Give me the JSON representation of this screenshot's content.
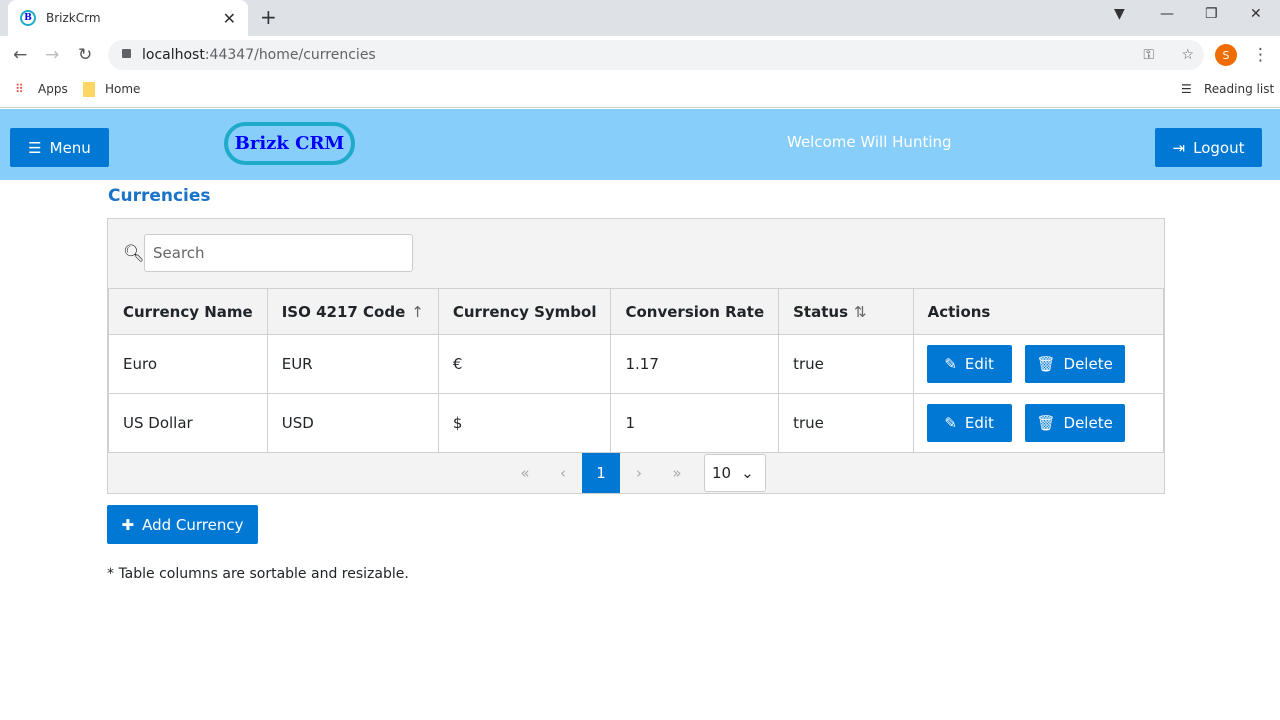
{
  "browser": {
    "tab_title": "BrizkCrm",
    "favicon_letter": "B",
    "url_host": "localhost",
    "url_path": ":44347/home/currencies",
    "profile_initial": "S",
    "bookmarks": [
      "Apps",
      "Home"
    ],
    "reading_list": "Reading list"
  },
  "header": {
    "menu_label": "Menu",
    "logo": "Brizk CRM",
    "welcome": "Welcome Will Hunting",
    "logout_label": "Logout"
  },
  "page": {
    "title": "Currencies",
    "search_placeholder": "Search",
    "note": "* Table columns are sortable and resizable.",
    "add_label": "Add Currency"
  },
  "table": {
    "columns": [
      "Currency Name",
      "ISO 4217 Code",
      "Currency Symbol",
      "Conversion Rate",
      "Status",
      "Actions"
    ],
    "rows": [
      {
        "name": "Euro",
        "code": "EUR",
        "symbol": "€",
        "rate": "1.17",
        "status": "true"
      },
      {
        "name": "US Dollar",
        "code": "USD",
        "symbol": "$",
        "rate": "1",
        "status": "true"
      }
    ],
    "edit_label": "Edit",
    "delete_label": "Delete"
  },
  "pager": {
    "current_page": "1",
    "page_size": "10"
  }
}
